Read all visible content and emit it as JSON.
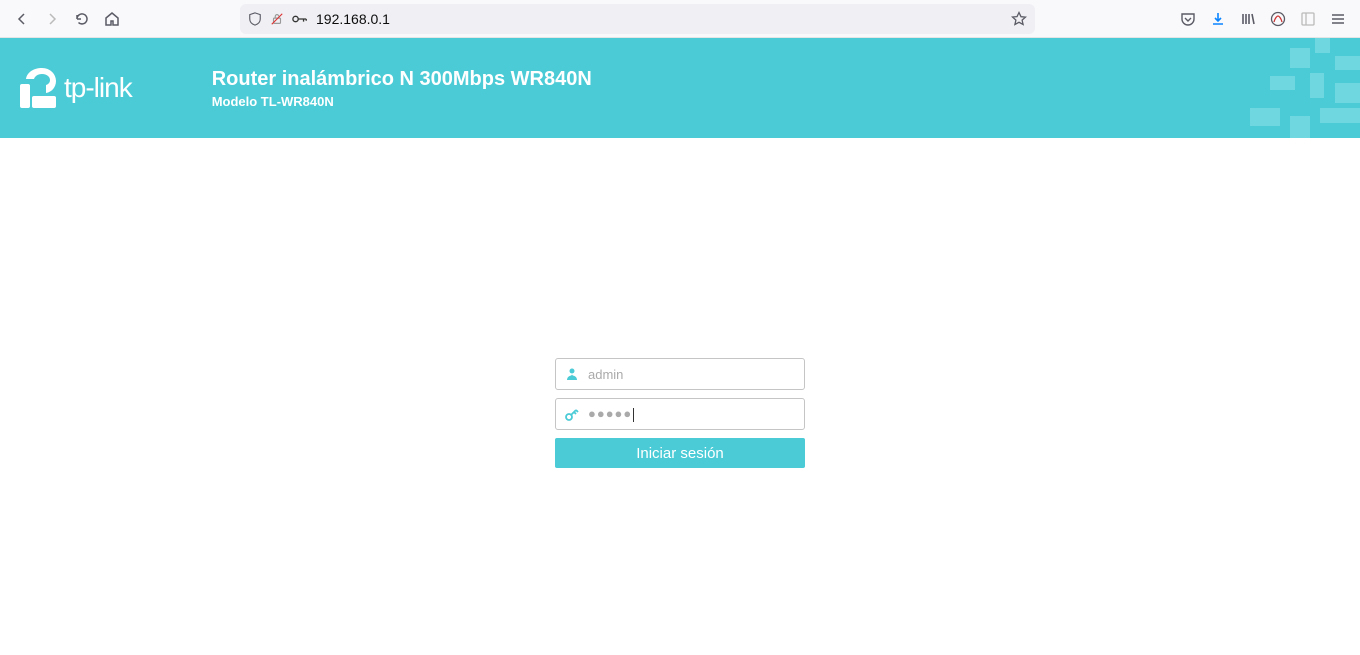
{
  "browser": {
    "url": "192.168.0.1"
  },
  "header": {
    "brand": "tp-link",
    "title": "Router inalámbrico N 300Mbps WR840N",
    "model": "Modelo TL-WR840N"
  },
  "login": {
    "username_placeholder": "admin",
    "password_masked": "●●●●●",
    "button_label": "Iniciar sesión"
  }
}
